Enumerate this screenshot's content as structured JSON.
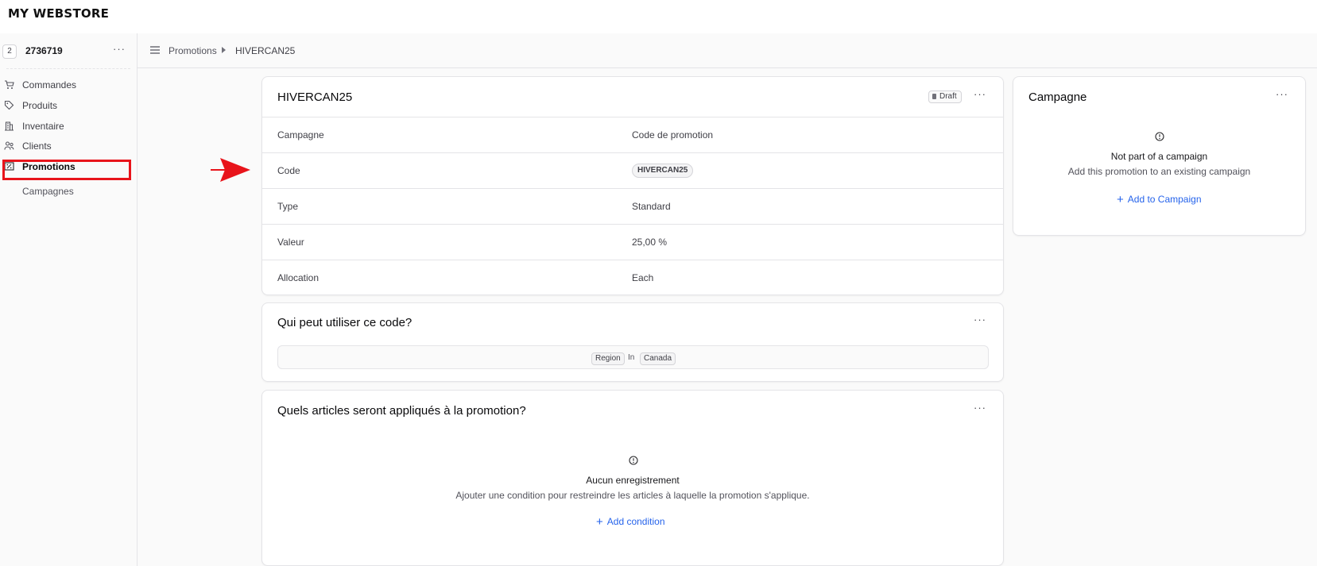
{
  "brand": "MY WEBSTORE",
  "store": {
    "badge": "2",
    "name": "2736719",
    "more": "···"
  },
  "sidebar": {
    "items": [
      {
        "label": "Commandes",
        "icon": "cart-icon"
      },
      {
        "label": "Produits",
        "icon": "tag-icon"
      },
      {
        "label": "Inventaire",
        "icon": "building-icon"
      },
      {
        "label": "Clients",
        "icon": "users-icon"
      },
      {
        "label": "Promotions",
        "icon": "receipt-percent-icon",
        "active": true
      }
    ],
    "subitems": [
      {
        "label": "Campagnes"
      }
    ]
  },
  "breadcrumb": {
    "parent": "Promotions",
    "current": "HIVERCAN25"
  },
  "promo": {
    "title": "HIVERCAN25",
    "status": "Draft",
    "more": "···",
    "rows": [
      {
        "label": "Campagne",
        "value": "Code de promotion"
      },
      {
        "label": "Code",
        "value": "HIVERCAN25"
      },
      {
        "label": "Type",
        "value": "Standard"
      },
      {
        "label": "Valeur",
        "value": "25,00 %"
      },
      {
        "label": "Allocation",
        "value": "Each"
      }
    ]
  },
  "who": {
    "title": "Qui peut utiliser ce code?",
    "more": "···",
    "rule": {
      "attribute": "Region",
      "operator": "In",
      "value": "Canada"
    }
  },
  "items": {
    "title": "Quels articles seront appliqués à la promotion?",
    "more": "···",
    "empty_title": "Aucun enregistrement",
    "empty_sub": "Ajouter une condition pour restreindre les articles à laquelle la promotion s'applique.",
    "add_label": "Add condition"
  },
  "campaign": {
    "title": "Campagne",
    "more": "···",
    "empty_title": "Not part of a campaign",
    "empty_sub": "Add this promotion to an existing campaign",
    "add_label": "Add to Campaign"
  },
  "colors": {
    "accent": "#2563eb",
    "highlight": "#e8141b"
  }
}
